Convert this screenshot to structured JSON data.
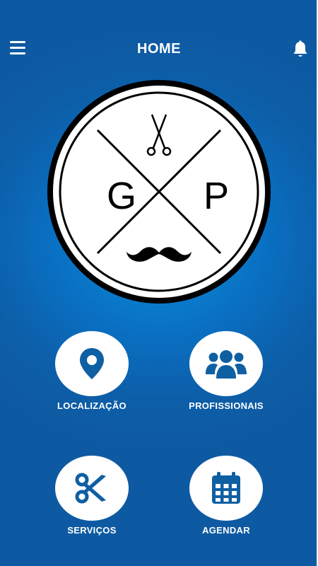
{
  "header": {
    "title": "HOME",
    "menu_icon": "hamburger-menu-icon",
    "notification_icon": "bell-icon"
  },
  "logo": {
    "letters": [
      "G",
      "P"
    ],
    "top_icon": "scissors-icon",
    "bottom_icon": "mustache-icon"
  },
  "tiles": [
    {
      "label": "LOCALIZAÇÃO",
      "icon": "location-pin-icon"
    },
    {
      "label": "PROFISSIONAIS",
      "icon": "users-group-icon"
    },
    {
      "label": "SERVIÇOS",
      "icon": "scissors-icon"
    },
    {
      "label": "AGENDAR",
      "icon": "calendar-icon"
    }
  ],
  "colors": {
    "primary_blue": "#0d5ea8",
    "icon_blue": "#0f5fa3",
    "white": "#ffffff"
  }
}
